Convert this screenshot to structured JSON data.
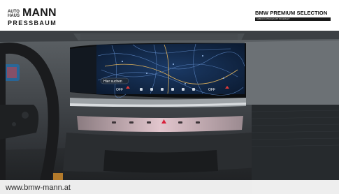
{
  "dealer_logo": {
    "prefix": "AUTO HAUS",
    "name": "MANN",
    "location": "PRESSBAUM"
  },
  "badge": {
    "title": "BMW PREMIUM SELECTION",
    "strap": "GEBRAUCHTWAGEN MIT SICHERHEIT"
  },
  "website": "www.bmw-mann.at",
  "display": {
    "search_label": "Hier suchen",
    "left_climate": "OFF",
    "right_climate": "OFF"
  },
  "colors": {
    "map_background": "#10233f",
    "hazard_button": "#d8203a",
    "light_bar": "#cfaab4"
  }
}
